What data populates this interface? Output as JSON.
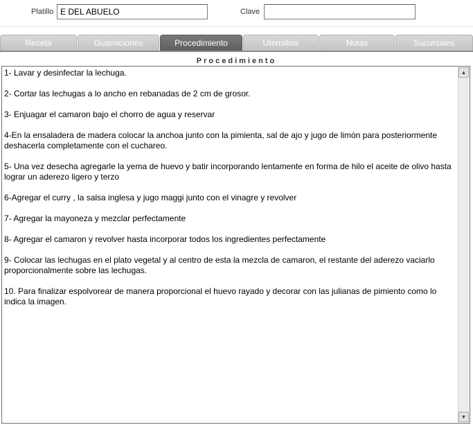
{
  "form": {
    "platillo_label": "Platillo",
    "platillo_value": "E DEL ABUELO",
    "clave_label": "Clave",
    "clave_value": ""
  },
  "tabs": [
    {
      "label": "Receta",
      "active": false
    },
    {
      "label": "Guarniciones",
      "active": false
    },
    {
      "label": "Procedimiento",
      "active": true
    },
    {
      "label": "Utensilios",
      "active": false
    },
    {
      "label": "Notas",
      "active": false
    },
    {
      "label": "Sucursales",
      "active": false
    }
  ],
  "procedimiento": {
    "title": "Procedimiento",
    "steps": [
      "1- Lavar y desinfectar la lechuga.",
      "2- Cortar las lechugas a lo ancho en rebanadas de 2 cm de grosor.",
      "3- Enjuagar el camaron bajo el chorro de agua y reservar",
      "4-En la ensaladera de madera  colocar  la anchoa junto con la pimienta, sal de ajo y jugo de limón para posteriormente deshacerla  completamente con el cuchareo.",
      "5- Una vez desecha agregarle la yema de huevo y batir  incorporando lentamente en forma de hilo el aceite de olivo hasta lograr un aderezo ligero y terzo",
      "6-Agregar el curry , la salsa inglesa y jugo maggi  junto con  el vinagre y revolver",
      "7- Agregar la mayoneza y mezclar perfectamente",
      "8- Agregar  el camaron y revolver hasta incorporar todos los ingredientes perfectamente",
      "9- Colocar las lechugas en el plato vegetal y al centro de esta la mezcla de camaron, el restante del aderezo vaciarlo proporcionalmente sobre las lechugas.",
      "10. Para finalizar espolvorear de manera proporcional el huevo rayado y decorar con las julianas de pimiento como lo indica la imagen."
    ]
  },
  "icons": {
    "scroll_up": "triangle-up-icon",
    "scroll_down": "triangle-down-icon"
  }
}
